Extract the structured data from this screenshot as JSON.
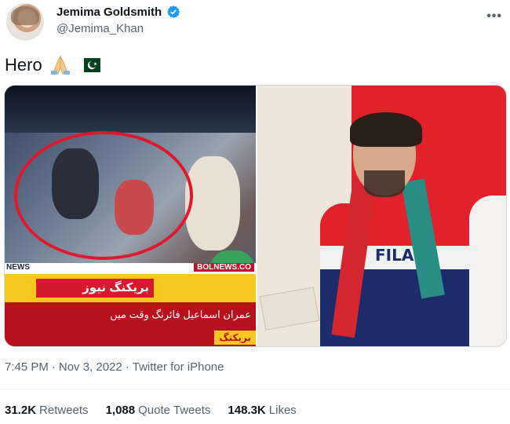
{
  "author": {
    "display_name": "Jemima Goldsmith",
    "handle": "@Jemima_Khan",
    "verified_icon": "verified-badge-icon",
    "more_icon": "•••"
  },
  "tweet": {
    "text": "Hero",
    "emojis": [
      "folded-hands-icon",
      "pakistan-flag-icon"
    ]
  },
  "media": {
    "left": {
      "news_label": "NEWS",
      "site": "BOLNEWS.CO",
      "breaking": "بریکنگ نیوز",
      "headline": "عمران اسماعیل فائرنگ وقت میں",
      "headline_tag": "بریکنگ"
    },
    "right": {
      "shirt_text": "FILA"
    }
  },
  "meta": {
    "time": "7:45 PM",
    "date": "Nov 3, 2022",
    "client": "Twitter for iPhone",
    "sep": "·"
  },
  "stats": {
    "retweets_count": "31.2K",
    "retweets_label": "Retweets",
    "quotes_count": "1,088",
    "quotes_label": "Quote Tweets",
    "likes_count": "148.3K",
    "likes_label": "Likes"
  },
  "colors": {
    "verified": "#1d9bf0",
    "secondary_text": "#536471",
    "primary_text": "#0f1419"
  }
}
